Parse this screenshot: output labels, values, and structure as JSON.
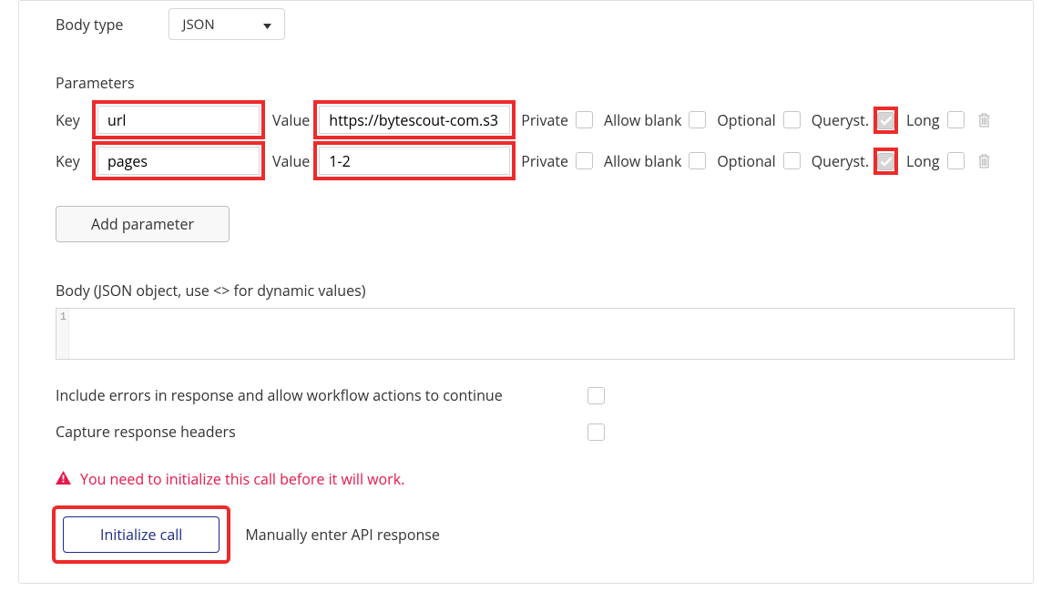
{
  "labels": {
    "body_type": "Body type",
    "parameters": "Parameters",
    "key": "Key",
    "value": "Value",
    "private": "Private",
    "allow_blank": "Allow blank",
    "optional": "Optional",
    "queryst": "Queryst.",
    "long": "Long",
    "add_parameter": "Add parameter",
    "body_json": "Body (JSON object, use <> for dynamic values)",
    "include_errors": "Include errors in response and allow workflow actions to continue",
    "capture_headers": "Capture response headers",
    "warning": "You need to initialize this call before it will work.",
    "initialize": "Initialize call",
    "manual": "Manually enter API response"
  },
  "body_type_select": {
    "value": "JSON"
  },
  "parameters": [
    {
      "key": "url",
      "value": "https://bytescout-com.s3",
      "private": false,
      "allow_blank": false,
      "optional": false,
      "queryst": true,
      "long": false
    },
    {
      "key": "pages",
      "value": "1-2",
      "private": false,
      "allow_blank": false,
      "optional": false,
      "queryst": true,
      "long": false
    }
  ],
  "editor": {
    "line_number": "1"
  }
}
